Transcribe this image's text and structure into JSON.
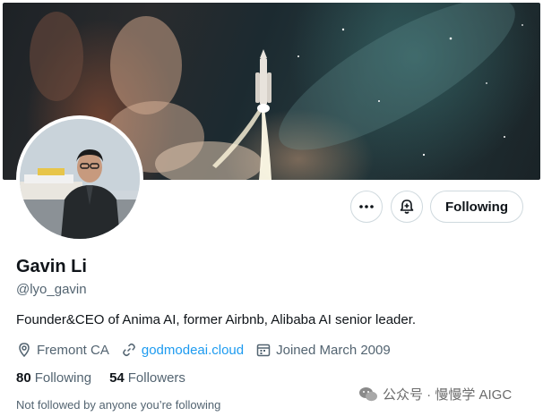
{
  "profile": {
    "name": "Gavin Li",
    "handle": "@lyo_gavin",
    "bio": "Founder&CEO of Anima AI, former Airbnb, Alibaba AI senior leader.",
    "location": "Fremont CA",
    "website": "godmodeai.cloud",
    "joined": "Joined March 2009"
  },
  "stats": {
    "following_count": "80",
    "following_label": "Following",
    "followers_count": "54",
    "followers_label": "Followers"
  },
  "followed_by": "Not followed by anyone you’re following",
  "actions": {
    "following_label": "Following"
  },
  "icons": {
    "more": "more-horizontal-icon",
    "notify": "bell-plus-icon",
    "location": "location-pin-icon",
    "link": "link-icon",
    "calendar": "calendar-icon"
  },
  "watermark": {
    "text": "公众号 · 慢慢学 AIGC"
  },
  "colors": {
    "link": "#1d9bf0",
    "text_primary": "#0f1419",
    "text_secondary": "#536471",
    "border": "#cfd9de"
  }
}
